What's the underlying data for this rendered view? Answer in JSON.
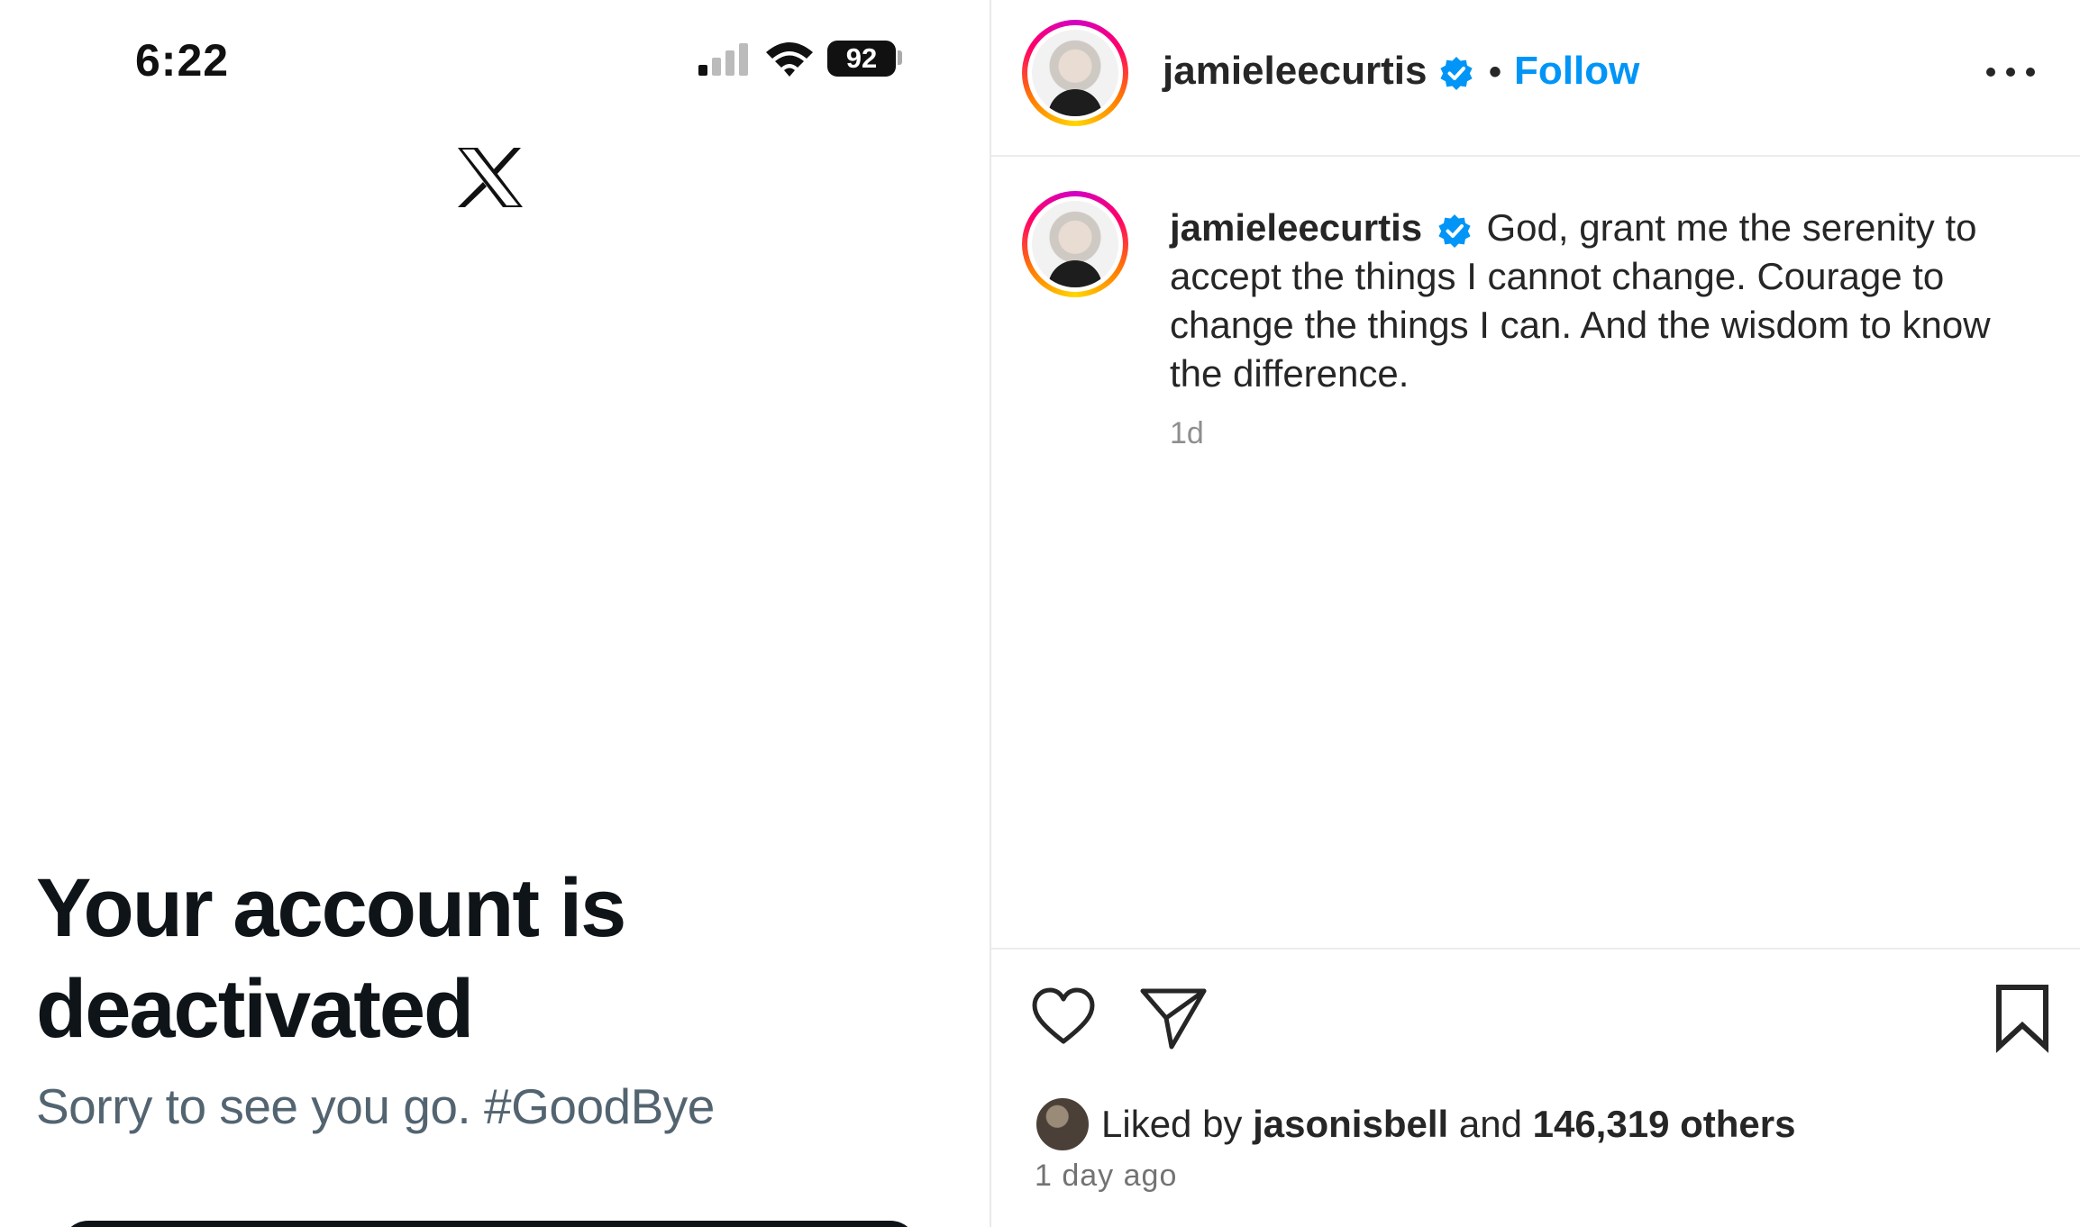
{
  "phone": {
    "time": "6:22",
    "battery": "92",
    "logo_icon": "x-logo-icon",
    "title": "Your account is deactivated",
    "subtitle": "Sorry to see you go. #GoodBye"
  },
  "instagram": {
    "header": {
      "username": "jamieleecurtis",
      "separator": "•",
      "follow_label": "Follow",
      "verified_icon": "verified-badge-icon",
      "more_icon": "more-options-icon"
    },
    "post": {
      "username": "jamieleecurtis",
      "caption": "God, grant me the serenity to accept the things I cannot change. Courage to change the things I can. And the wisdom to know the difference.",
      "time_short": "1d"
    },
    "actions": {
      "like_icon": "heart-icon",
      "share_icon": "send-icon",
      "save_icon": "bookmark-icon"
    },
    "likes": {
      "prefix": "Liked by",
      "liker": "jasonisbell",
      "middle": "and",
      "others": "146,319 others"
    },
    "time_long": "1 day ago"
  },
  "colors": {
    "follow_blue": "#0095f6",
    "verified_blue": "#0095f6",
    "x_title": "#0f1419",
    "x_subtitle": "#536471"
  }
}
